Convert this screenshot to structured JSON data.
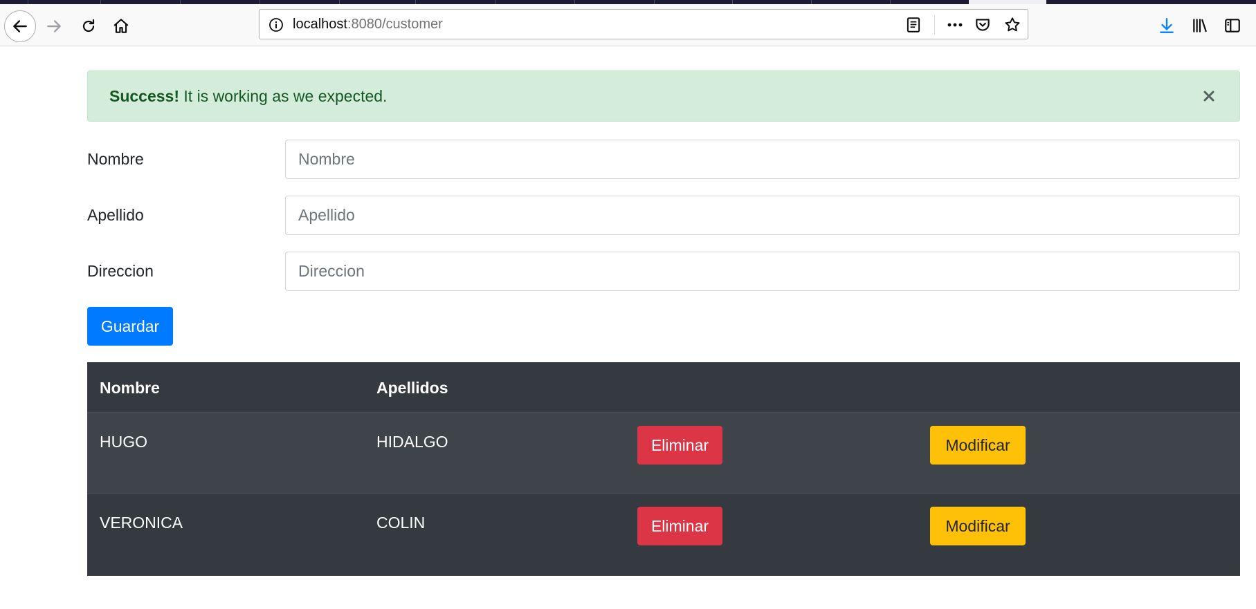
{
  "browser": {
    "url_host": "localhost",
    "url_path": ":8080/customer"
  },
  "alert": {
    "strong": "Success!",
    "message": "It is working as we expected.",
    "close": "×"
  },
  "form": {
    "nombre": {
      "label": "Nombre",
      "placeholder": "Nombre"
    },
    "apellido": {
      "label": "Apellido",
      "placeholder": "Apellido"
    },
    "direccion": {
      "label": "Direccion",
      "placeholder": "Direccion"
    },
    "save_label": "Guardar"
  },
  "table": {
    "headers": [
      "Nombre",
      "Apellidos"
    ],
    "rows": [
      {
        "nombre": "HUGO",
        "apellidos": "HIDALGO",
        "delete": "Eliminar",
        "edit": "Modificar"
      },
      {
        "nombre": "VERONICA",
        "apellidos": "COLIN",
        "delete": "Eliminar",
        "edit": "Modificar"
      }
    ]
  },
  "colors": {
    "primary": "#007bff",
    "danger": "#dc3545",
    "warning": "#ffc107",
    "success_bg": "#d4edda",
    "table_dark": "#343a40"
  }
}
